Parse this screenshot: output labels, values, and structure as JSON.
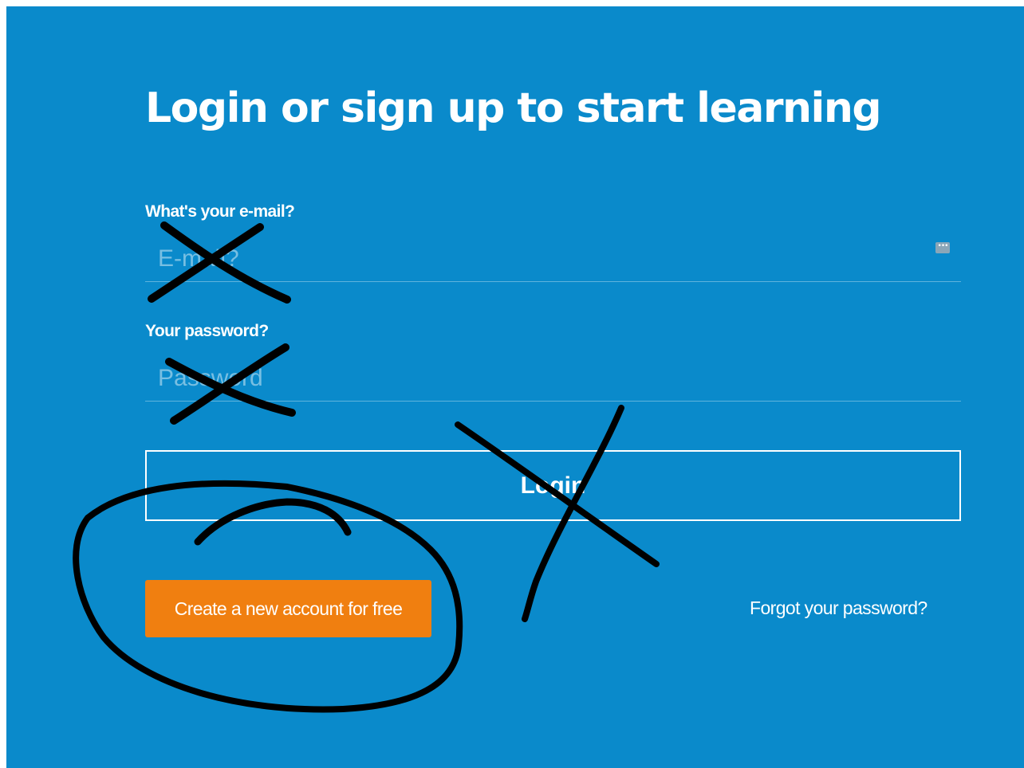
{
  "page": {
    "title": "Login or sign up to start learning"
  },
  "email": {
    "label": "What's your e-mail?",
    "placeholder": "E-mail?",
    "value": ""
  },
  "password": {
    "label": "Your password?",
    "placeholder": "Password",
    "value": ""
  },
  "password_manager_icon": {
    "icon": "password-manager-icon",
    "glyph": "•••"
  },
  "actions": {
    "login_label": "Login",
    "create_account_label": "Create a new account for free",
    "forgot_password_label": "Forgot your password?"
  },
  "colors": {
    "background": "#0a8acb",
    "create_button": "#f07f10",
    "scribble_ink": "#000000"
  }
}
